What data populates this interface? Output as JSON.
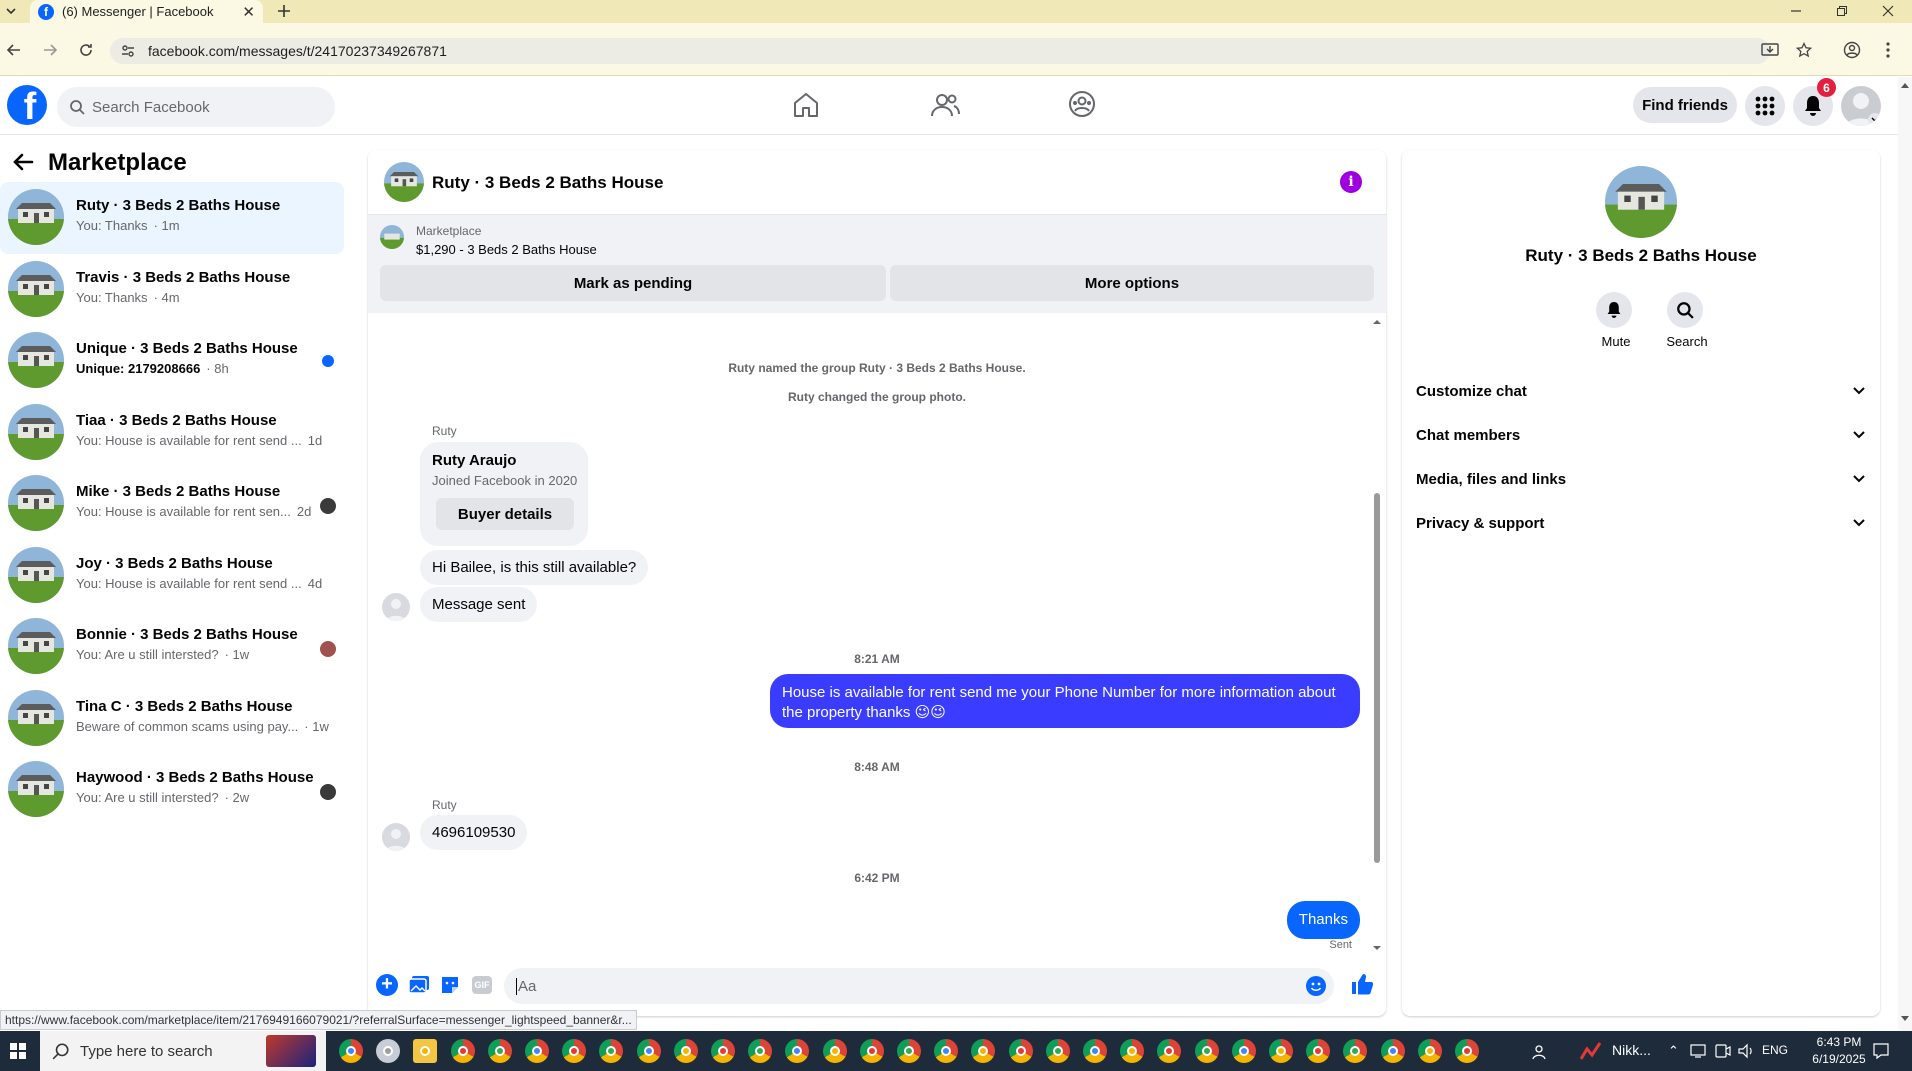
{
  "browser": {
    "tab_title": "(6) Messenger | Facebook",
    "url": "facebook.com/messages/t/24170237349267871",
    "status_link": "https://www.facebook.com/marketplace/item/2176949166079021/?referralSurface=messenger_lightspeed_banner&r..."
  },
  "fbnav": {
    "search_placeholder": "Search Facebook",
    "find_friends": "Find friends",
    "notif_count": "6"
  },
  "left": {
    "title": "Marketplace",
    "conversations": [
      {
        "title": "Ruty · 3 Beds 2 Baths House",
        "preview": "You: Thanks",
        "time": "· 1m"
      },
      {
        "title": "Travis · 3 Beds 2 Baths House",
        "preview": "You: Thanks",
        "time": "· 4m"
      },
      {
        "title": "Unique · 3 Beds 2 Baths House",
        "preview": "Unique: 2179208666",
        "time": "· 8h"
      },
      {
        "title": "Tiaa · 3 Beds 2 Baths House",
        "preview": "You: House is available for rent send ...",
        "time": "1d"
      },
      {
        "title": "Mike · 3 Beds 2 Baths House",
        "preview": "You: House is available for rent sen...",
        "time": "2d"
      },
      {
        "title": "Joy · 3 Beds 2 Baths House",
        "preview": "You: House is available for rent send ...",
        "time": "4d"
      },
      {
        "title": "Bonnie · 3 Beds 2 Baths House",
        "preview": "You: Are u still intersted?",
        "time": "· 1w"
      },
      {
        "title": "Tina C · 3 Beds 2 Baths House",
        "preview": "Beware of common scams using pay...",
        "time": "· 1w"
      },
      {
        "title": "Haywood · 3 Beds 2 Baths House",
        "preview": "You: Are u still intersted?",
        "time": "· 2w"
      }
    ]
  },
  "chat": {
    "title": "Ruty · 3 Beds 2 Baths House",
    "marketplace_label": "Marketplace",
    "listing": "$1,290 - 3 Beds 2 Baths House",
    "mark_pending": "Mark as pending",
    "more_options": "More options",
    "sys1": "Ruty named the group Ruty · 3 Beds 2 Baths House.",
    "sys2": "Ruty changed the group photo.",
    "sender1": "Ruty",
    "profile_name": "Ruty Araujo",
    "profile_joined": "Joined Facebook in 2020",
    "buyer_details": "Buyer details",
    "msg_available": "Hi Bailee, is this still available?",
    "msg_sent": "Message sent",
    "time1": "8:21 AM",
    "out_msg": "House is available for rent send me your Phone Number for more information about the property thanks 😉😉",
    "time2": "8:48 AM",
    "sender2": "Ruty",
    "msg_phone": "4696109530",
    "time3": "6:42 PM",
    "out_thanks": "Thanks",
    "sent_label": "Sent",
    "composer_placeholder": "Aa"
  },
  "rpanel": {
    "title": "Ruty · 3 Beds 2 Baths House",
    "mute": "Mute",
    "search": "Search",
    "sections": [
      "Customize chat",
      "Chat members",
      "Media, files and links",
      "Privacy & support"
    ]
  },
  "taskbar": {
    "search_placeholder": "Type here to search",
    "app_label": "Nikk...",
    "lang": "ENG",
    "time": "6:43 PM",
    "date": "6/19/2025"
  },
  "colors": {
    "fb_blue": "#0866ff",
    "outgoing_bubble": "#3a3dff",
    "info_purple": "#a000e0"
  }
}
